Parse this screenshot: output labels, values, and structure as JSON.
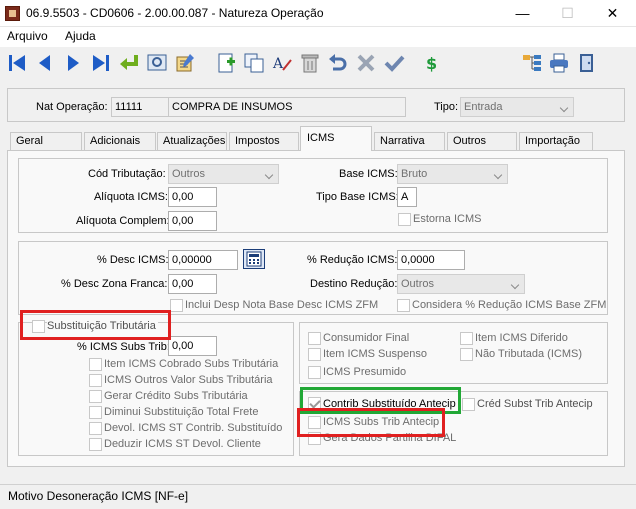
{
  "window": {
    "title": "06.9.5503 - CD0606 - 2.00.00.087 - Natureza Operação",
    "minimize": "—",
    "maximize": "☐",
    "close": "✕"
  },
  "menu": {
    "arquivo": "Arquivo",
    "ajuda": "Ajuda"
  },
  "header": {
    "nat_label": "Nat Operação:",
    "nat_code": "11111",
    "nat_desc": "COMPRA DE INSUMOS",
    "tipo_label": "Tipo:",
    "tipo_value": "Entrada"
  },
  "tabs": [
    "Geral",
    "Adicionais",
    "Atualizações",
    "Impostos",
    "ICMS",
    "Narrativa",
    "Outros",
    "Importação"
  ],
  "icms": {
    "cod_trib_label": "Cód Tributação:",
    "cod_trib_value": "Outros",
    "aliq_label": "Alíquota ICMS:",
    "aliq_value": "0,00",
    "aliq_compl_label": "Alíquota Complem:",
    "aliq_compl_value": "0,00",
    "base_label": "Base ICMS:",
    "base_value": "Bruto",
    "tipo_base_label": "Tipo Base ICMS:",
    "tipo_base_value": "A",
    "estorna_label": "Estorna ICMS",
    "desc_label": "% Desc ICMS:",
    "desc_value": "0,00000",
    "desc_zf_label": "% Desc Zona Franca:",
    "desc_zf_value": "0,00",
    "inclui_label": "Inclui Desp Nota Base Desc ICMS ZFM",
    "reducao_label": "% Redução ICMS:",
    "reducao_value": "0,0000",
    "destino_label": "Destino Redução:",
    "destino_value": "Outros",
    "considera_label": "Considera % Redução ICMS Base ZFM"
  },
  "subst": {
    "title": "Substituição Tributária",
    "pct_label": "% ICMS Subs Trib:",
    "pct_value": "0,00",
    "items": [
      "Item ICMS Cobrado Subs Tributária",
      "ICMS Outros Valor Subs Tributária",
      "Gerar Crédito Subs Tributária",
      "Diminui Substituição Total Frete",
      "Devol. ICMS ST Contrib. Substituído",
      "Deduzir ICMS ST Devol. Cliente"
    ]
  },
  "right": {
    "consumidor": "Consumidor Final",
    "item_diferido": "Item ICMS Diferido",
    "item_suspenso": "Item ICMS Suspenso",
    "nao_tributada": "Não Tributada (ICMS)",
    "presumido": "ICMS Presumido",
    "contrib": "Contrib Substituído Antecip",
    "cred_subst": "Créd Subst Trib Antecip",
    "icms_subs_antecip": "ICMS Subs Trib Antecip",
    "gera_dados": "Gera Dados Partilha DIFAL"
  },
  "status": {
    "text": "Motivo Desoneração ICMS [NF-e]"
  },
  "colors": {
    "highlight_red": "#e02020",
    "highlight_green": "#21a836"
  },
  "toolbar_icons": [
    "first-icon",
    "prev-icon",
    "next-icon",
    "last-icon",
    "return-icon",
    "preview-icon",
    "edit-list-icon",
    "new-icon",
    "copy-icon",
    "text-edit-icon",
    "delete-icon",
    "undo-icon",
    "cancel-icon",
    "confirm-icon",
    "currency-icon",
    "tree-icon",
    "print-icon",
    "exit-icon"
  ]
}
